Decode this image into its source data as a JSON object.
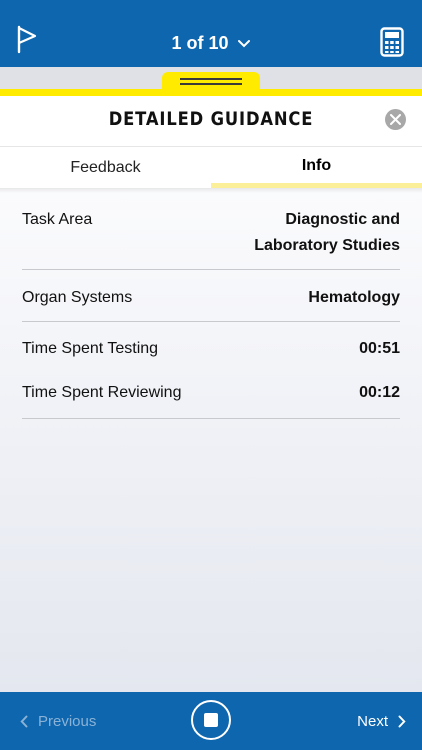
{
  "header": {
    "counter": "1 of 10",
    "colors": {
      "bar": "#0d66ae",
      "accent": "#ffeb00"
    },
    "icons": {
      "flag": "flag-icon",
      "dropdown": "chevron-down-icon",
      "calculator": "calculator-icon"
    }
  },
  "sheet": {
    "title": "DETAILED GUIDANCE",
    "close_icon": "close-icon"
  },
  "tabs": [
    {
      "label": "Feedback",
      "selected": false
    },
    {
      "label": "Info",
      "selected": true
    }
  ],
  "info": {
    "rows": [
      {
        "label": "Task Area",
        "value_line1": "Diagnostic and",
        "value_line2": "Laboratory Studies"
      },
      {
        "label": "Organ Systems",
        "value": "Hematology"
      },
      {
        "label": "Time Spent Testing",
        "value": "00:51"
      },
      {
        "label": "Time Spent Reviewing",
        "value": "00:12"
      }
    ]
  },
  "footer": {
    "previous_label": "Previous",
    "next_label": "Next",
    "stop_icon": "stop-icon"
  }
}
